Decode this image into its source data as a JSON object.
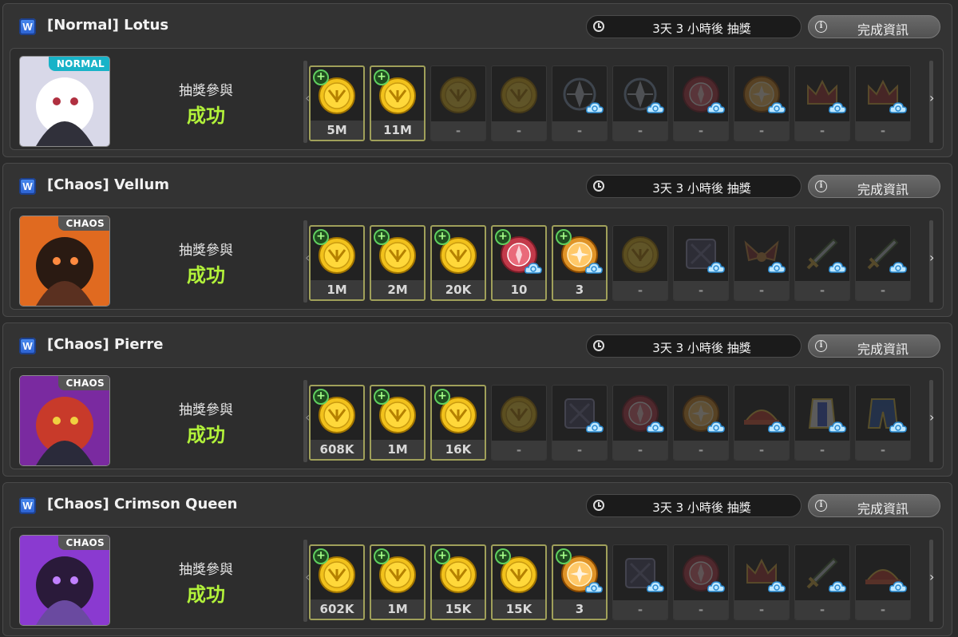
{
  "panels": [
    {
      "title": "[Normal] Lotus",
      "difficulty": "NORMAL",
      "difficulty_color": "#18b3c8",
      "timer": "3天 3 小時後 抽獎",
      "info_button": "完成資訊",
      "participate_label": "抽獎參與",
      "result": "成功",
      "rewards": [
        {
          "icon": "gold-coin-icon",
          "value": "5M",
          "obtained": true
        },
        {
          "icon": "gold-coin-icon",
          "value": "11M",
          "obtained": true
        },
        {
          "icon": "gold-coin-icon",
          "value": "-",
          "obtained": false
        },
        {
          "icon": "gold-coin-icon",
          "value": "-",
          "obtained": false
        },
        {
          "icon": "emblem-icon",
          "value": "-",
          "obtained": false
        },
        {
          "icon": "emblem-icon",
          "value": "-",
          "obtained": false
        },
        {
          "icon": "red-orb-icon",
          "value": "-",
          "obtained": false
        },
        {
          "icon": "orange-orb-icon",
          "value": "-",
          "obtained": false
        },
        {
          "icon": "crown-icon",
          "value": "-",
          "obtained": false
        },
        {
          "icon": "crown-icon",
          "value": "-",
          "obtained": false
        }
      ]
    },
    {
      "title": "[Chaos] Vellum",
      "difficulty": "CHAOS",
      "difficulty_color": "#555555",
      "timer": "3天 3 小時後 抽獎",
      "info_button": "完成資訊",
      "participate_label": "抽獎參與",
      "result": "成功",
      "rewards": [
        {
          "icon": "gold-coin-icon",
          "value": "1M",
          "obtained": true
        },
        {
          "icon": "gold-coin-icon",
          "value": "2M",
          "obtained": true
        },
        {
          "icon": "gold-coin-icon",
          "value": "20K",
          "obtained": true
        },
        {
          "icon": "red-orb-icon",
          "value": "10",
          "obtained": true
        },
        {
          "icon": "orange-orb-icon",
          "value": "3",
          "obtained": true
        },
        {
          "icon": "gold-coin-icon",
          "value": "-",
          "obtained": false
        },
        {
          "icon": "dark-box-icon",
          "value": "-",
          "obtained": false
        },
        {
          "icon": "wings-icon",
          "value": "-",
          "obtained": false
        },
        {
          "icon": "sword-icon",
          "value": "-",
          "obtained": false
        },
        {
          "icon": "sword-icon",
          "value": "-",
          "obtained": false
        }
      ]
    },
    {
      "title": "[Chaos] Pierre",
      "difficulty": "CHAOS",
      "difficulty_color": "#555555",
      "timer": "3天 3 小時後 抽獎",
      "info_button": "完成資訊",
      "participate_label": "抽獎參與",
      "result": "成功",
      "rewards": [
        {
          "icon": "gold-coin-icon",
          "value": "608K",
          "obtained": true
        },
        {
          "icon": "gold-coin-icon",
          "value": "1M",
          "obtained": true
        },
        {
          "icon": "gold-coin-icon",
          "value": "16K",
          "obtained": true
        },
        {
          "icon": "gold-coin-icon",
          "value": "-",
          "obtained": false
        },
        {
          "icon": "dark-box-icon",
          "value": "-",
          "obtained": false
        },
        {
          "icon": "red-orb-icon",
          "value": "-",
          "obtained": false
        },
        {
          "icon": "orange-orb-icon",
          "value": "-",
          "obtained": false
        },
        {
          "icon": "hat-icon",
          "value": "-",
          "obtained": false
        },
        {
          "icon": "outfit-icon",
          "value": "-",
          "obtained": false
        },
        {
          "icon": "pants-icon",
          "value": "-",
          "obtained": false
        }
      ]
    },
    {
      "title": "[Chaos] Crimson Queen",
      "difficulty": "CHAOS",
      "difficulty_color": "#555555",
      "timer": "3天 3 小時後 抽獎",
      "info_button": "完成資訊",
      "participate_label": "抽獎參與",
      "result": "成功",
      "rewards": [
        {
          "icon": "gold-coin-icon",
          "value": "602K",
          "obtained": true
        },
        {
          "icon": "gold-coin-icon",
          "value": "1M",
          "obtained": true
        },
        {
          "icon": "gold-coin-icon",
          "value": "15K",
          "obtained": true
        },
        {
          "icon": "gold-coin-icon",
          "value": "15K",
          "obtained": true
        },
        {
          "icon": "orange-orb-icon",
          "value": "3",
          "obtained": true
        },
        {
          "icon": "dark-box-icon",
          "value": "-",
          "obtained": false
        },
        {
          "icon": "red-orb-icon",
          "value": "-",
          "obtained": false
        },
        {
          "icon": "crown-icon",
          "value": "-",
          "obtained": false
        },
        {
          "icon": "sword-icon",
          "value": "-",
          "obtained": false
        },
        {
          "icon": "hat-icon",
          "value": "-",
          "obtained": false
        }
      ]
    }
  ]
}
